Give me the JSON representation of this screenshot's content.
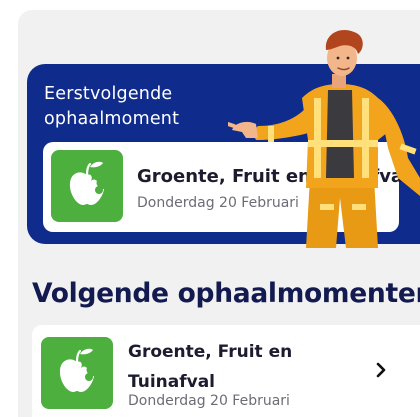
{
  "hero": {
    "title": "Eerstvolgende ophaalmoment",
    "item": {
      "title": "Groente, Fruit en Tuinafval",
      "date": "Donderdag 20 Februari",
      "icon": "apple-icon",
      "color": "#4caf3e"
    }
  },
  "upcoming": {
    "title": "Volgende ophaalmomenten",
    "items": [
      {
        "title": "Groente, Fruit en Tuinafval",
        "date": "Donderdag 20 Februari",
        "icon": "apple-icon",
        "color": "#4caf3e"
      }
    ]
  },
  "colors": {
    "brand_navy": "#0f2b8c",
    "heading_navy": "#121a4f",
    "gft_green": "#4caf3e",
    "worker_vest": "#f2a51c"
  }
}
